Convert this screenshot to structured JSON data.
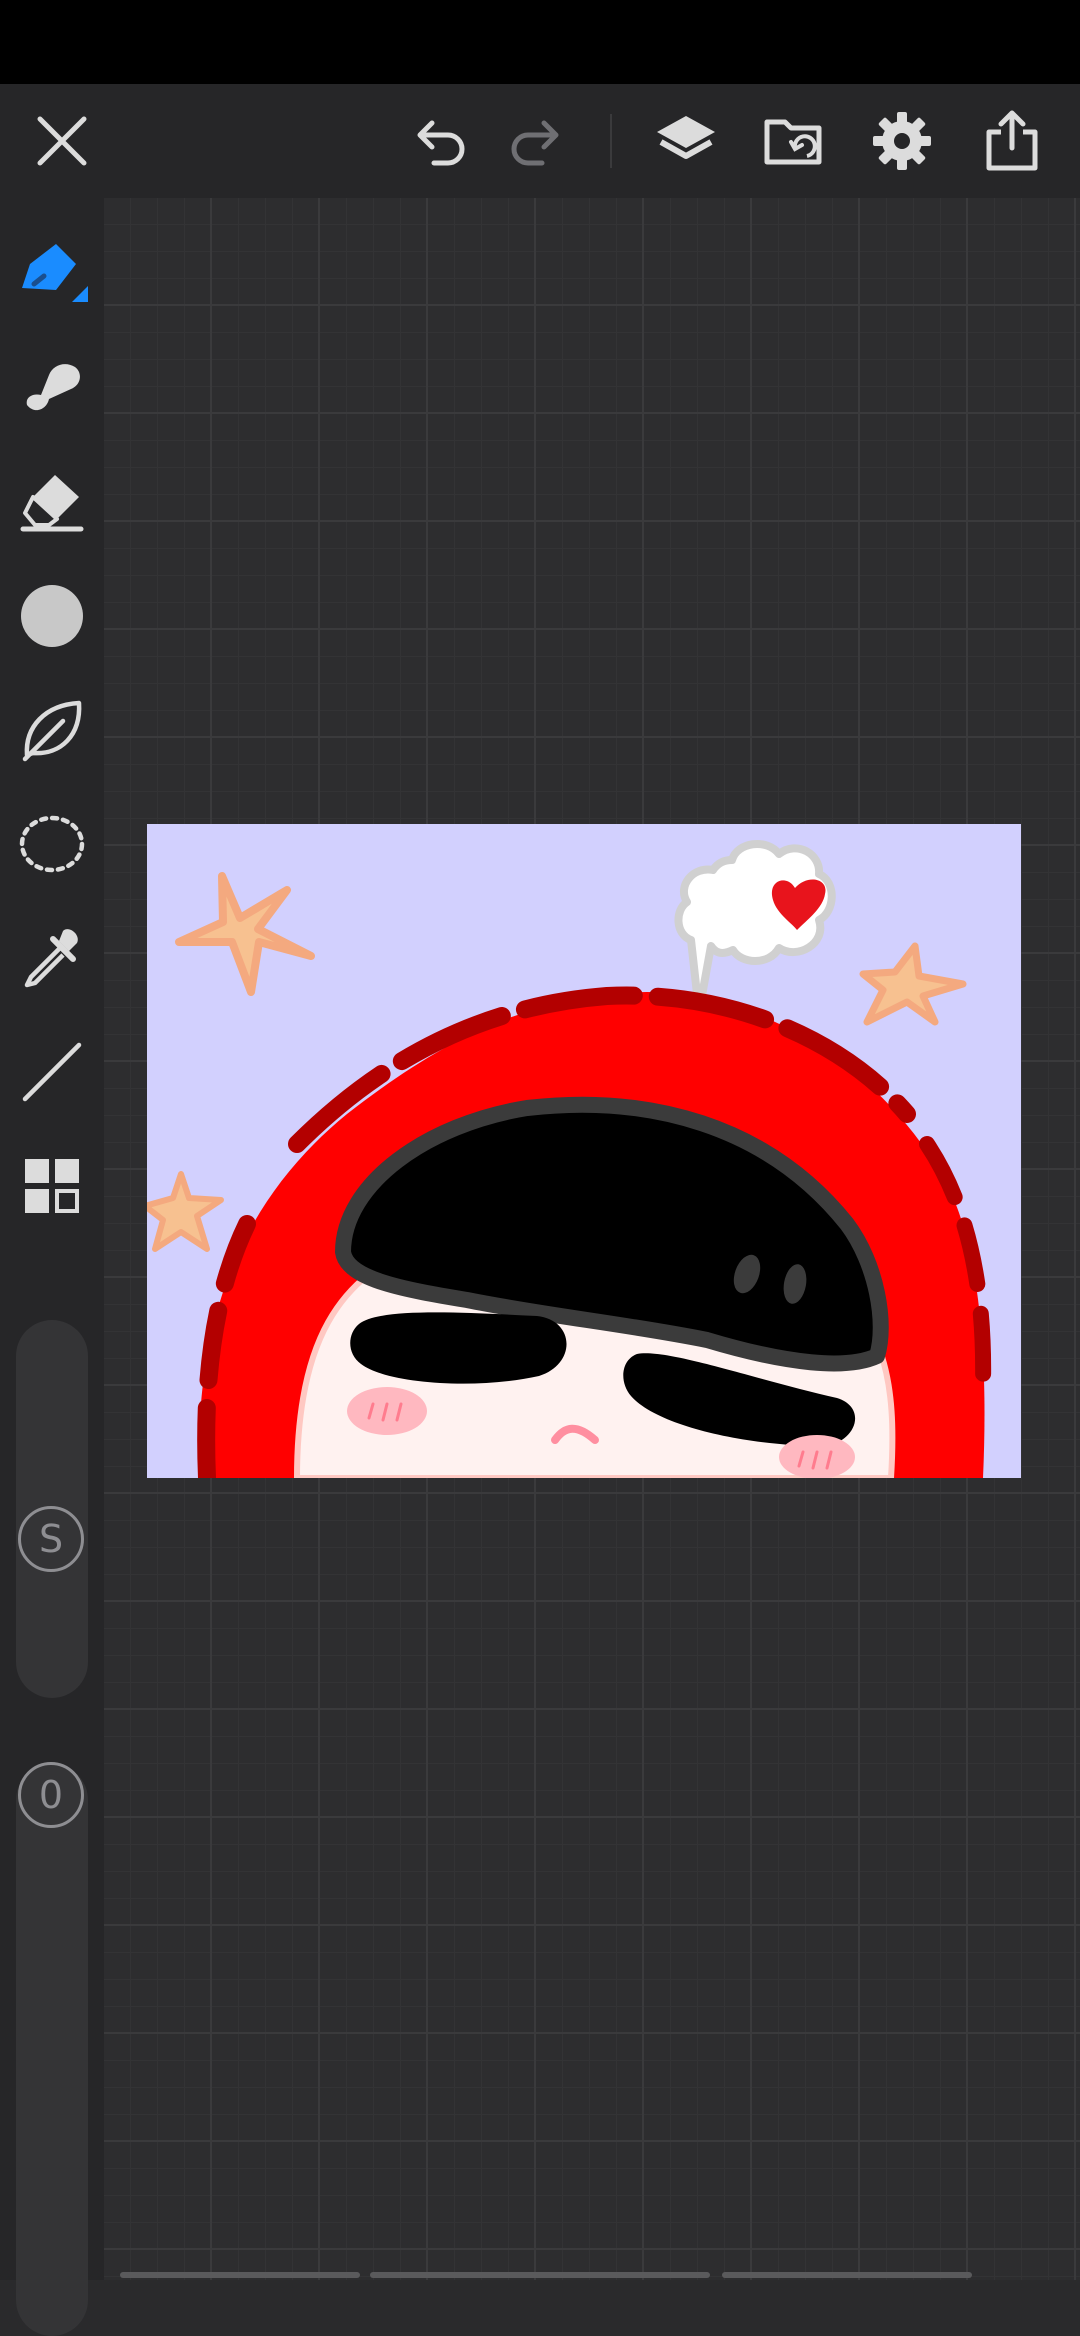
{
  "app": {
    "accent_color": "#1a8cff",
    "icon_color": "#dcdcdc",
    "disabled_icon_color": "#6f6f73"
  },
  "top_toolbar": {
    "close": "close-icon",
    "undo": "undo-icon",
    "redo": "redo-icon",
    "layers": "layers-icon",
    "gallery": "gallery-folder-icon",
    "settings": "gear-icon",
    "share": "share-icon"
  },
  "tools": [
    {
      "name": "pen-tool",
      "icon": "pen-icon",
      "active": true
    },
    {
      "name": "smudge-tool",
      "icon": "smudge-icon"
    },
    {
      "name": "eraser-tool",
      "icon": "eraser-icon"
    },
    {
      "name": "color-picker",
      "icon": "color-swatch-icon",
      "color": "#c8c8c8"
    },
    {
      "name": "fill-tool",
      "icon": "leaf-icon"
    },
    {
      "name": "lasso-tool",
      "icon": "lasso-icon"
    },
    {
      "name": "eyedropper-tool",
      "icon": "eyedropper-icon"
    },
    {
      "name": "line-tool",
      "icon": "line-icon"
    },
    {
      "name": "more-tools",
      "icon": "grid-icon"
    }
  ],
  "sliders": {
    "size_label": "S",
    "opacity_label": "0"
  },
  "canvas": {
    "background_color": "#d2d0fe",
    "hood_color": "#ff0000",
    "hair_color": "#000000"
  }
}
